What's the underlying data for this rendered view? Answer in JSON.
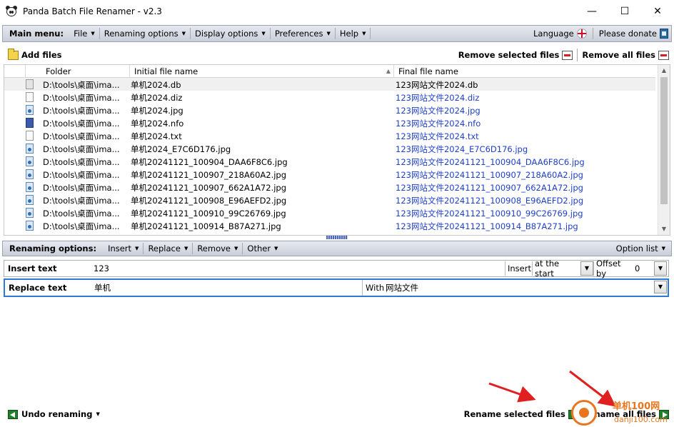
{
  "window": {
    "title": "Panda Batch File Renamer - v2.3",
    "minimize": "—",
    "maximize": "☐",
    "close": "✕"
  },
  "main_menu": {
    "label": "Main menu:",
    "items": [
      "File",
      "Renaming options",
      "Display options",
      "Preferences",
      "Help"
    ],
    "language": "Language",
    "donate": "Please donate"
  },
  "files_toolbar": {
    "add_files": "Add files",
    "remove_selected": "Remove selected files",
    "remove_all": "Remove all files"
  },
  "table": {
    "columns": [
      "Folder",
      "Initial file name",
      "Final file name"
    ],
    "rows": [
      {
        "icon": "db",
        "folder": "D:\\tools\\桌面\\ima...",
        "initial": "单机2024.db",
        "final": "123网站文件2024.db"
      },
      {
        "icon": "file",
        "folder": "D:\\tools\\桌面\\ima...",
        "initial": "单机2024.diz",
        "final": "123网站文件2024.diz"
      },
      {
        "icon": "img",
        "folder": "D:\\tools\\桌面\\ima...",
        "initial": "单机2024.jpg",
        "final": "123网站文件2024.jpg"
      },
      {
        "icon": "nfo",
        "folder": "D:\\tools\\桌面\\ima...",
        "initial": "单机2024.nfo",
        "final": "123网站文件2024.nfo"
      },
      {
        "icon": "file",
        "folder": "D:\\tools\\桌面\\ima...",
        "initial": "单机2024.txt",
        "final": "123网站文件2024.txt"
      },
      {
        "icon": "img",
        "folder": "D:\\tools\\桌面\\ima...",
        "initial": "单机2024_E7C6D176.jpg",
        "final": "123网站文件2024_E7C6D176.jpg"
      },
      {
        "icon": "img",
        "folder": "D:\\tools\\桌面\\ima...",
        "initial": "单机20241121_100904_DAA6F8C6.jpg",
        "final": "123网站文件20241121_100904_DAA6F8C6.jpg"
      },
      {
        "icon": "img",
        "folder": "D:\\tools\\桌面\\ima...",
        "initial": "单机20241121_100907_218A60A2.jpg",
        "final": "123网站文件20241121_100907_218A60A2.jpg"
      },
      {
        "icon": "img",
        "folder": "D:\\tools\\桌面\\ima...",
        "initial": "单机20241121_100907_662A1A72.jpg",
        "final": "123网站文件20241121_100907_662A1A72.jpg"
      },
      {
        "icon": "img",
        "folder": "D:\\tools\\桌面\\ima...",
        "initial": "单机20241121_100908_E96AEFD2.jpg",
        "final": "123网站文件20241121_100908_E96AEFD2.jpg"
      },
      {
        "icon": "img",
        "folder": "D:\\tools\\桌面\\ima...",
        "initial": "单机20241121_100910_99C26769.jpg",
        "final": "123网站文件20241121_100910_99C26769.jpg"
      },
      {
        "icon": "img",
        "folder": "D:\\tools\\桌面\\ima...",
        "initial": "单机20241121_100914_B87A271.jpg",
        "final": "123网站文件20241121_100914_B87A271.jpg"
      }
    ]
  },
  "renaming_bar": {
    "label": "Renaming options:",
    "items": [
      "Insert",
      "Replace",
      "Remove",
      "Other"
    ],
    "option_list": "Option list"
  },
  "insert_row": {
    "name": "Insert text",
    "value": "123",
    "insert_label": "Insert",
    "position": "at the start",
    "offset_label": "Offset by",
    "offset_value": "0"
  },
  "replace_row": {
    "name": "Replace text",
    "value": "单机",
    "with_label": "With",
    "with_value": "网站文件"
  },
  "bottom_toolbar": {
    "undo": "Undo renaming",
    "rename_selected": "Rename selected files",
    "rename_all": "Rename all files"
  },
  "watermark": {
    "text_top": "单机100网",
    "text_bottom": "danji100.com"
  },
  "colors": {
    "accent_blue": "#2e79d6",
    "final_name_blue": "#1f40c8",
    "annotation_red": "#e02020"
  }
}
